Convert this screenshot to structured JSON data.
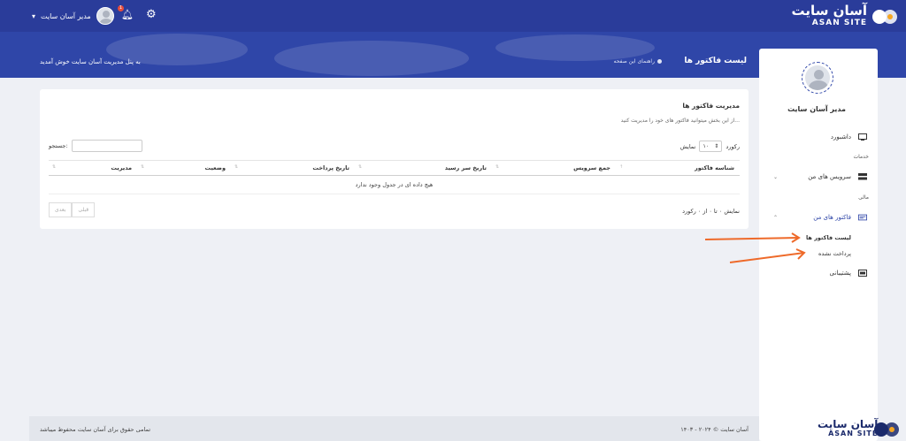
{
  "brand": {
    "name_fa": "آسان سایت",
    "name_en": "ASAN SITE",
    "primary_color": "#2f46a8",
    "accent_color": "#f5a623"
  },
  "topbar": {
    "user_name": "مدیر آسان سایت",
    "notification_count": "1",
    "bell_icon": "bell-icon",
    "settings_icon": "gear-icon"
  },
  "header": {
    "page_title": "لیست فاکتور ها",
    "guide_label": "راهنمای این صفحه",
    "welcome": "به پنل مدیریت آسان سایت خوش آمدید"
  },
  "sidebar": {
    "user_name": "مدیر آسان سایت",
    "items": [
      {
        "label": "داشبورد",
        "icon": "monitor-icon"
      },
      {
        "label": "سرویس های من",
        "icon": "server-icon"
      },
      {
        "label": "فاکتور های من",
        "icon": "invoice-icon"
      },
      {
        "label": "پشتیبانی",
        "icon": "support-icon"
      }
    ],
    "sections": {
      "services": "خدمات",
      "finance": "مالی"
    },
    "subitems": [
      "لیست فاکتور ها",
      "پرداخت نشده"
    ]
  },
  "card": {
    "title": "مدیریت فاکتور ها",
    "description": "از این بخش میتوانید فاکتور های خود را مدیریت کنید...",
    "length_label_show": "نمایش",
    "length_value": "۱۰",
    "length_label_records": "رکورد",
    "search_label": "جستجو:",
    "columns": [
      "شناسه فاکتور",
      "جمع سرویس",
      "تاریخ سر رسید",
      "تاریخ پرداخت",
      "وضعیت",
      "مدیریت"
    ],
    "empty_message": "هیچ داده ای در جدول وجود ندارد",
    "info": "نمایش ۰ تا ۰ از ۰ رکورد",
    "prev": "قبلی",
    "next": "بعدی"
  },
  "footer": {
    "copyright": "۱۴۰۳ - ۲۰۲۴ © آسان سایت",
    "rights": "تمامی حقوق برای آسان سایت محفوظ میباشد"
  }
}
